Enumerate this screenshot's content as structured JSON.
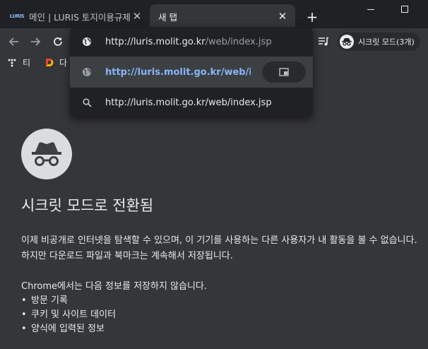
{
  "tabs": [
    {
      "favicon_text": "LURIS",
      "title": "메인 | LURIS 토지이용규제",
      "close": "✕"
    },
    {
      "title": "새 탭",
      "close": "✕"
    }
  ],
  "new_tab": "+",
  "toolbar": {
    "back": "←",
    "forward": "→",
    "reload": "C",
    "incognito_label": "시크릿 모드(3개)"
  },
  "bookmarks": [
    {
      "label": "티",
      "icon": "tistory-icon"
    },
    {
      "label": "다",
      "icon": "daum-icon"
    }
  ],
  "omnibox": {
    "rows": [
      {
        "icon": "globe-icon",
        "text_host": "http://luris.molit.go.kr",
        "text_path": "/web/index.jsp"
      },
      {
        "icon": "globe-icon",
        "text": "http://luris.molit.go.kr/web/index.jsp",
        "action_icon": "switch-to-tab-icon"
      },
      {
        "icon": "search-icon",
        "text": "http://luris.molit.go.kr/web/index.jsp"
      }
    ]
  },
  "content": {
    "heading": "시크릿 모드로 전환됨",
    "paragraph": "이제 비공개로 인터넷을 탐색할 수 있으며, 이 기기를 사용하는 다른 사용자가 내 활동을 볼 수 없습니다. 하지만 다운로드 파일과 북마크는 계속해서 저장됩니다.",
    "subheading": "Chrome에서는 다음 정보를 저장하지 않습니다.",
    "items": [
      "방문 기록",
      "쿠키 및 사이트 데이터",
      "양식에 입력된 정보"
    ]
  },
  "colors": {
    "frame": "#202124",
    "toolbar": "#35363a",
    "page": "#35363a",
    "text": "#e8eaed",
    "link": "#8ab4f8",
    "dim": "#9aa0a6"
  }
}
